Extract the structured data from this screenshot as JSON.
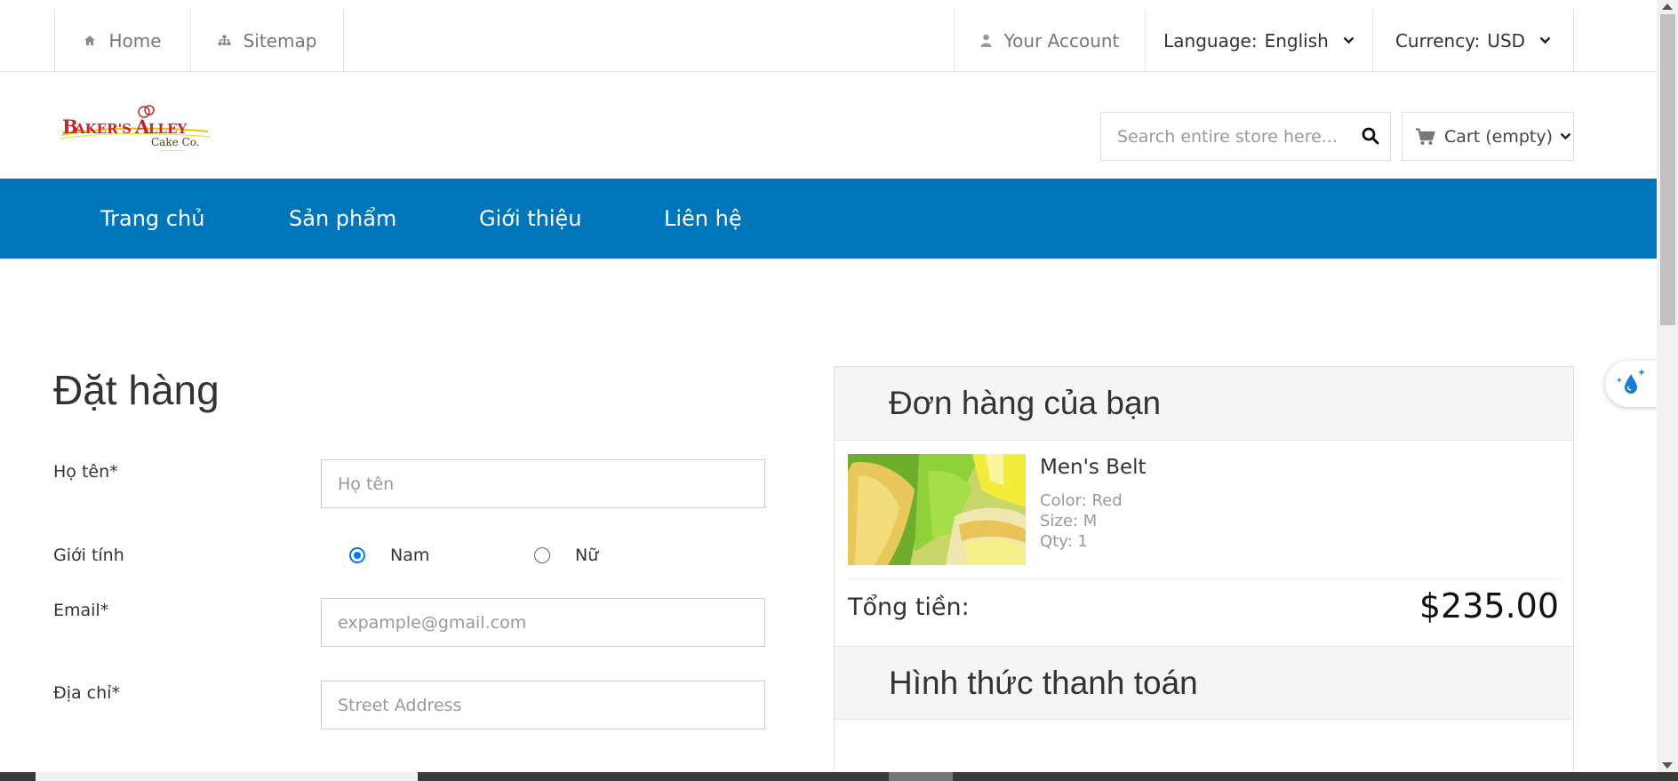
{
  "topbar": {
    "home": "Home",
    "sitemap": "Sitemap",
    "account": "Your Account",
    "language_label": "Language:",
    "language_value": "English",
    "currency_label": "Currency:",
    "currency_value": "USD"
  },
  "header": {
    "logo_text": "Baker's Alley Cake Co.",
    "search_placeholder": "Search entire store here...",
    "cart_label": "Cart (empty)"
  },
  "nav": {
    "items": [
      "Trang chủ",
      "Sản phẩm",
      "Giới thiệu",
      "Liên hệ"
    ]
  },
  "form": {
    "title": "Đặt hàng",
    "name_label": "Họ tên*",
    "name_placeholder": "Họ tên",
    "gender_label": "Giới tính",
    "gender_male": "Nam",
    "gender_female": "Nữ",
    "gender_selected": "Nam",
    "email_label": "Email*",
    "email_placeholder": "expample@gmail.com",
    "address_label": "Địa chỉ*",
    "address_placeholder": "Street Address"
  },
  "order": {
    "title": "Đơn hàng của bạn",
    "product": {
      "name": "Men's Belt",
      "color": "Color: Red",
      "size": "Size: M",
      "qty": "Qty: 1"
    },
    "total_label": "Tổng tiền:",
    "total_value": "$235.00",
    "payment_title": "Hình thức thanh toán"
  },
  "colors": {
    "nav_bg": "#0075b9",
    "radio_accent": "#0075ff"
  },
  "icons": [
    "home-icon",
    "sitemap-icon",
    "user-icon",
    "chevron-down-icon",
    "search-icon",
    "cart-icon",
    "water-drop-icon"
  ]
}
